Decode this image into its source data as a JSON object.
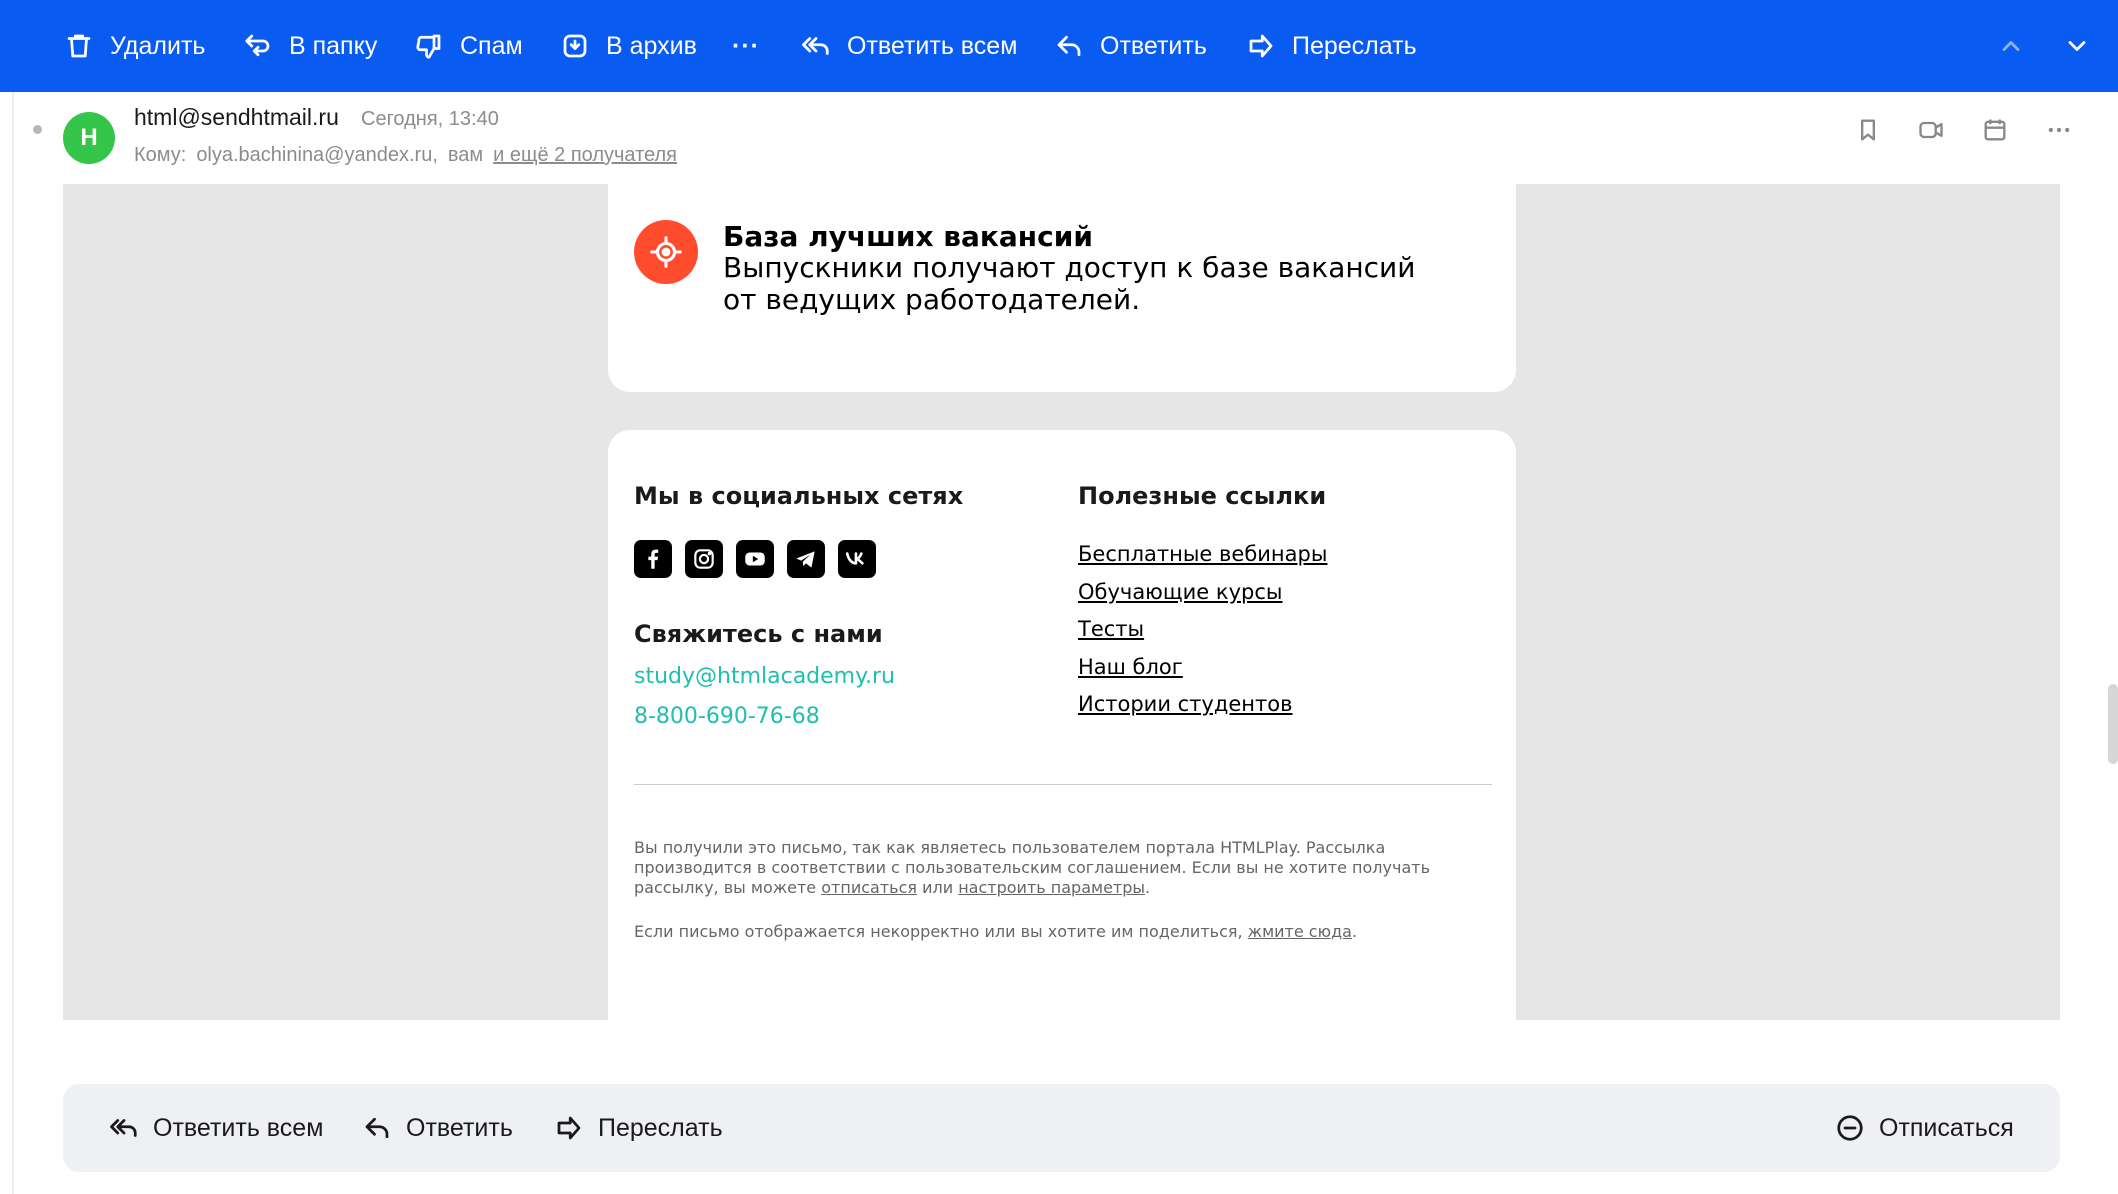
{
  "toolbar": {
    "delete": "Удалить",
    "to_folder": "В папку",
    "spam": "Спам",
    "archive": "В архив",
    "more": "···",
    "reply_all": "Ответить всем",
    "reply": "Ответить",
    "forward": "Переслать"
  },
  "message": {
    "avatar_letter": "H",
    "from": "html@sendhtmail.ru",
    "date": "Сегодня, 13:40",
    "to_label": "Кому:",
    "to_address": "olya.bachinina@yandex.ru,",
    "to_you": "вам",
    "more_recipients": "и ещё 2 получателя"
  },
  "email": {
    "vacancies": {
      "title": "База лучших вакансий",
      "text": "Выпускники получают доступ к базе вакансий от ведущих работодателей."
    },
    "social": {
      "heading": "Мы в социальных сетях",
      "icons": [
        "facebook-icon",
        "instagram-icon",
        "youtube-icon",
        "telegram-icon",
        "vk-icon"
      ]
    },
    "contact": {
      "heading": "Свяжитесь с нами",
      "email": "study@htmlacademy.ru",
      "phone": "8-800-690-76-68"
    },
    "useful_links": {
      "heading": "Полезные ссылки",
      "items": [
        "Бесплатные вебинары",
        "Обучающие курсы",
        "Тесты",
        "Наш блог",
        "Истории студентов"
      ]
    },
    "footer": {
      "p1_text": "Вы получили это письмо, так как являетесь пользователем портала HTMLPlay. Рассылка производится в соответствии с пользовательским соглашением. Если вы не хотите получать рассылку, вы можете",
      "unsubscribe_link": "отписаться",
      "or": "или",
      "settings_link": "настроить параметры",
      "p2_text": "Если письмо отображается некорректно или вы хотите им поделиться,",
      "view_link": "жмите сюда"
    }
  },
  "bottom_bar": {
    "reply_all": "Ответить всем",
    "reply": "Ответить",
    "forward": "Переслать",
    "unsubscribe": "Отписаться"
  },
  "colors": {
    "toolbar": "#0a5bf2",
    "avatar": "#35c54a",
    "accent_icon": "#ff4c2e",
    "contact_link": "#1fbfb0"
  }
}
